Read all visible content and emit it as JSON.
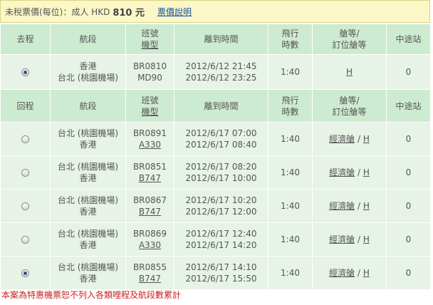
{
  "fare": {
    "label": "未稅票價(每位)：成人 HKD",
    "amount": "810 元",
    "link": "票價說明"
  },
  "headers": {
    "col_route": "航段",
    "col_flight_1": "班號",
    "col_flight_2": "機型",
    "col_time": "離到時間",
    "col_duration_1": "飛行",
    "col_duration_2": "時數",
    "col_class_1": "艙等/",
    "col_class_2": "訂位艙等",
    "col_stops": "中途站"
  },
  "outbound": {
    "label": "去程",
    "rows": [
      {
        "from": "香港",
        "to": "台北 (桃園機場)",
        "flight": "BR0810",
        "aircraft": "MD90",
        "dep": "2012/6/12 21:45",
        "arr": "2012/6/12 23:25",
        "duration": "1:40",
        "cabin": "",
        "booking_class": "H",
        "stops": "0",
        "selected": true
      }
    ]
  },
  "return": {
    "label": "回程",
    "rows": [
      {
        "from": "台北 (桃園機場)",
        "to": "香港",
        "flight": "BR0891",
        "aircraft": "A330",
        "dep": "2012/6/17 07:00",
        "arr": "2012/6/17 08:40",
        "duration": "1:40",
        "cabin": "經濟艙",
        "booking_class": "H",
        "stops": "0",
        "selected": false
      },
      {
        "from": "台北 (桃園機場)",
        "to": "香港",
        "flight": "BR0851",
        "aircraft": "B747",
        "dep": "2012/6/17 08:20",
        "arr": "2012/6/17 10:00",
        "duration": "1:40",
        "cabin": "經濟艙",
        "booking_class": "H",
        "stops": "0",
        "selected": false
      },
      {
        "from": "台北 (桃園機場)",
        "to": "香港",
        "flight": "BR0867",
        "aircraft": "B747",
        "dep": "2012/6/17 10:20",
        "arr": "2012/6/17 12:00",
        "duration": "1:40",
        "cabin": "經濟艙",
        "booking_class": "H",
        "stops": "0",
        "selected": false
      },
      {
        "from": "台北 (桃園機場)",
        "to": "香港",
        "flight": "BR0869",
        "aircraft": "A330",
        "dep": "2012/6/17 12:40",
        "arr": "2012/6/17 14:20",
        "duration": "1:40",
        "cabin": "經濟艙",
        "booking_class": "H",
        "stops": "0",
        "selected": false
      },
      {
        "from": "台北 (桃園機場)",
        "to": "香港",
        "flight": "BR0855",
        "aircraft": "B747",
        "dep": "2012/6/17 14:10",
        "arr": "2012/6/17 15:50",
        "duration": "1:40",
        "cabin": "經濟艙",
        "booking_class": "H",
        "stops": "0",
        "selected": true
      }
    ]
  },
  "footer_note": "本案為特惠機票恕不列入各類哩程及航段數累計",
  "colors": {
    "header_bg": "#cdebd0",
    "row_bg": "#e6f3e6",
    "fare_bg": "#fbf7c6",
    "note_red": "#cc1f1f",
    "link_blue": "#1a55a0"
  }
}
